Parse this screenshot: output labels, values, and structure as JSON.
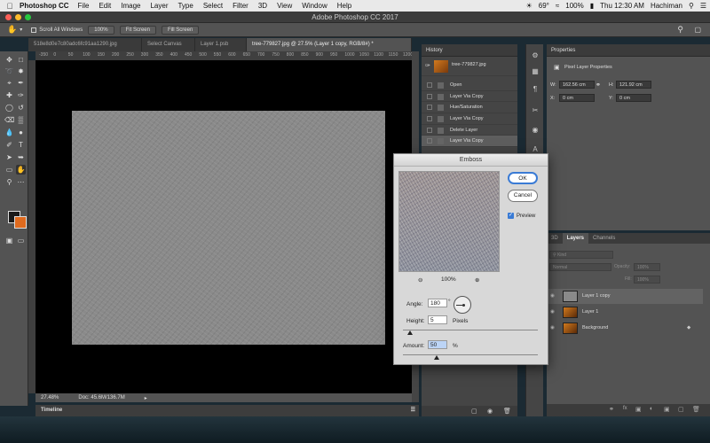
{
  "menubar": {
    "app": "Photoshop CC",
    "items": [
      "File",
      "Edit",
      "Image",
      "Layer",
      "Type",
      "Select",
      "Filter",
      "3D",
      "View",
      "Window",
      "Help"
    ],
    "temp": "69°",
    "battery": "100%",
    "clock": "Thu 12:30 AM",
    "user": "Hachiman"
  },
  "window": {
    "title": "Adobe Photoshop CC 2017"
  },
  "options": {
    "scroll_all": "Scroll All Windows",
    "zoom_btn": "100%",
    "fit_btn": "Fit Screen",
    "fill_btn": "Fill Screen"
  },
  "tabs": [
    {
      "label": "518e8d0e7c80adc6fc91aa1290.jpg"
    },
    {
      "label": "Select Canvas"
    },
    {
      "label": "Layer 1.psb"
    },
    {
      "label": "tree-779827.jpg @ 27.5% (Layer 1 copy, RGB/8#) *"
    }
  ],
  "ruler_top": [
    "-350",
    "0",
    "50",
    "100",
    "150",
    "200",
    "250",
    "300",
    "350",
    "400",
    "450",
    "500",
    "550",
    "600",
    "650",
    "700",
    "750",
    "800",
    "850",
    "900",
    "950",
    "1000",
    "1050",
    "1100",
    "1150",
    "1200"
  ],
  "status": {
    "zoom": "27.48%",
    "doc": "Doc: 45.6M/136.7M"
  },
  "timeline": {
    "label": "Timeline"
  },
  "history": {
    "title": "History",
    "snapshot": "tree-779827.jpg",
    "steps": [
      "Open",
      "Layer Via Copy",
      "Hue/Saturation",
      "Layer Via Copy",
      "Delete Layer",
      "Layer Via Copy"
    ]
  },
  "properties": {
    "title": "Properties",
    "subtitle": "Pixel Layer Properties",
    "w_label": "W:",
    "w_value": "162.56 cm",
    "h_label": "H:",
    "h_value": "121.92 cm",
    "x_label": "X:",
    "x_value": "0 cm",
    "y_label": "Y:",
    "y_value": "0 cm"
  },
  "layers_panel": {
    "tabs": [
      "3D",
      "Layers",
      "Channels"
    ],
    "kind": "Kind",
    "blend": "Normal",
    "opacity_label": "Opacity:",
    "opacity": "100%",
    "fill_label": "Fill:",
    "fill": "100%",
    "layers": [
      {
        "name": "Layer 1 copy"
      },
      {
        "name": "Layer 1"
      },
      {
        "name": "Background"
      }
    ]
  },
  "emboss": {
    "title": "Emboss",
    "ok": "OK",
    "cancel": "Cancel",
    "preview_label": "Preview",
    "zoom": "100%",
    "angle_label": "Angle:",
    "angle_value": "180",
    "angle_unit": "°",
    "height_label": "Height:",
    "height_value": "5",
    "height_unit": "Pixels",
    "amount_label": "Amount:",
    "amount_value": "50",
    "amount_unit": "%",
    "height_fraction": 0.05,
    "amount_fraction": 0.25
  }
}
